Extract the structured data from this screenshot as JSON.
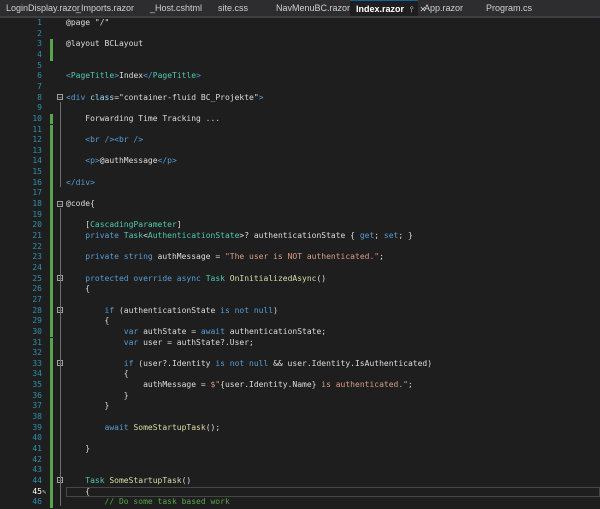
{
  "tabs": [
    {
      "label": "LoginDisplay.razor",
      "active": false
    },
    {
      "label": "_Imports.razor",
      "active": false
    },
    {
      "label": "_Host.cshtml",
      "active": false
    },
    {
      "label": "site.css",
      "active": false
    },
    {
      "label": "NavMenuBC.razor",
      "active": false
    },
    {
      "label": "Index.razor",
      "active": true
    },
    {
      "label": "App.razor",
      "active": false
    },
    {
      "label": "Program.cs",
      "active": false
    }
  ],
  "active_tab_icons": {
    "pin": "pin-icon",
    "close": "close-icon"
  },
  "colors": {
    "keyword": "#569cd6",
    "type": "#4ec9b0",
    "method": "#dcdcaa",
    "string": "#d69d85",
    "comment": "#57a64a",
    "change_bar": "#57a64a",
    "line_number": "#2b91af"
  },
  "current_line": 45,
  "lines": [
    {
      "n": 1,
      "tokens": [
        [
          "cx",
          "@page \"/\""
        ]
      ]
    },
    {
      "n": 2,
      "tokens": []
    },
    {
      "n": 3,
      "tokens": [
        [
          "cx",
          "@layout BCLayout"
        ]
      ]
    },
    {
      "n": 4,
      "tokens": []
    },
    {
      "n": 5,
      "tokens": []
    },
    {
      "n": 6,
      "tokens": [
        [
          "tg",
          "<"
        ],
        [
          "ty",
          "PageTitle"
        ],
        [
          "tg",
          ">"
        ],
        [
          "cx",
          "Index"
        ],
        [
          "tg",
          "</"
        ],
        [
          "ty",
          "PageTitle"
        ],
        [
          "tg",
          ">"
        ]
      ]
    },
    {
      "n": 7,
      "tokens": []
    },
    {
      "n": 8,
      "tokens": [
        [
          "tg",
          "<div "
        ],
        [
          "at",
          "class"
        ],
        [
          "cx",
          "=\"container-fluid BC_Projekte\""
        ],
        [
          "tg",
          ">"
        ]
      ]
    },
    {
      "n": 9,
      "tokens": []
    },
    {
      "n": 10,
      "tokens": [
        [
          "cx",
          "    Forwarding Time Tracking ..."
        ]
      ]
    },
    {
      "n": 11,
      "tokens": []
    },
    {
      "n": 12,
      "tokens": [
        [
          "cx",
          "    "
        ],
        [
          "tg",
          "<br /><br />"
        ]
      ]
    },
    {
      "n": 13,
      "tokens": []
    },
    {
      "n": 14,
      "tokens": [
        [
          "cx",
          "    "
        ],
        [
          "tg",
          "<p>"
        ],
        [
          "cx",
          "@authMessage"
        ],
        [
          "tg",
          "</p>"
        ]
      ]
    },
    {
      "n": 15,
      "tokens": []
    },
    {
      "n": 16,
      "tokens": [
        [
          "tg",
          "</div>"
        ]
      ]
    },
    {
      "n": 17,
      "tokens": []
    },
    {
      "n": 18,
      "tokens": [
        [
          "cx",
          "@code{"
        ]
      ]
    },
    {
      "n": 19,
      "tokens": []
    },
    {
      "n": 20,
      "tokens": [
        [
          "cx",
          "    ["
        ],
        [
          "ty",
          "CascadingParameter"
        ],
        [
          "cx",
          "]"
        ]
      ]
    },
    {
      "n": 21,
      "tokens": [
        [
          "kw",
          "    private "
        ],
        [
          "ty",
          "Task"
        ],
        [
          "cx",
          "<"
        ],
        [
          "ty",
          "AuthenticationState"
        ],
        [
          "cx",
          ">? authenticationState { "
        ],
        [
          "kw",
          "get"
        ],
        [
          "cx",
          "; "
        ],
        [
          "kw",
          "set"
        ],
        [
          "cx",
          "; }"
        ]
      ]
    },
    {
      "n": 22,
      "tokens": []
    },
    {
      "n": 23,
      "tokens": [
        [
          "kw",
          "    private string "
        ],
        [
          "cx",
          "authMessage = "
        ],
        [
          "st",
          "\"The user is NOT authenticated.\""
        ],
        [
          "cx",
          ";"
        ]
      ]
    },
    {
      "n": 24,
      "tokens": []
    },
    {
      "n": 25,
      "tokens": [
        [
          "kw",
          "    protected override async "
        ],
        [
          "ty",
          "Task "
        ],
        [
          "fn",
          "OnInitializedAsync"
        ],
        [
          "cx",
          "()"
        ]
      ]
    },
    {
      "n": 26,
      "tokens": [
        [
          "cx",
          "    {"
        ]
      ]
    },
    {
      "n": 27,
      "tokens": []
    },
    {
      "n": 28,
      "tokens": [
        [
          "kw",
          "        if "
        ],
        [
          "cx",
          "(authenticationState "
        ],
        [
          "kw",
          "is not null"
        ],
        [
          "cx",
          ")"
        ]
      ]
    },
    {
      "n": 29,
      "tokens": [
        [
          "cx",
          "        {"
        ]
      ]
    },
    {
      "n": 30,
      "tokens": [
        [
          "kw",
          "            var "
        ],
        [
          "cx",
          "authState = "
        ],
        [
          "kw",
          "await "
        ],
        [
          "cx",
          "authenticationState;"
        ]
      ]
    },
    {
      "n": 31,
      "tokens": [
        [
          "kw",
          "            var "
        ],
        [
          "cx",
          "user = authState?.User;"
        ]
      ]
    },
    {
      "n": 32,
      "tokens": []
    },
    {
      "n": 33,
      "tokens": [
        [
          "kw",
          "            if "
        ],
        [
          "cx",
          "(user?.Identity "
        ],
        [
          "kw",
          "is not null "
        ],
        [
          "cx",
          "&& user.Identity.IsAuthenticated)"
        ]
      ]
    },
    {
      "n": 34,
      "tokens": [
        [
          "cx",
          "            {"
        ]
      ]
    },
    {
      "n": 35,
      "tokens": [
        [
          "cx",
          "                authMessage = "
        ],
        [
          "st",
          "$\""
        ],
        [
          "cx",
          "{user.Identity.Name}"
        ],
        [
          "st",
          " is authenticated.\""
        ],
        [
          "cx",
          ";"
        ]
      ]
    },
    {
      "n": 36,
      "tokens": [
        [
          "cx",
          "            }"
        ]
      ]
    },
    {
      "n": 37,
      "tokens": [
        [
          "cx",
          "        }"
        ]
      ]
    },
    {
      "n": 38,
      "tokens": []
    },
    {
      "n": 39,
      "tokens": [
        [
          "kw",
          "        await "
        ],
        [
          "fn",
          "SomeStartupTask"
        ],
        [
          "cx",
          "();"
        ]
      ]
    },
    {
      "n": 40,
      "tokens": []
    },
    {
      "n": 41,
      "tokens": [
        [
          "cx",
          "    }"
        ]
      ]
    },
    {
      "n": 42,
      "tokens": []
    },
    {
      "n": 43,
      "tokens": []
    },
    {
      "n": 44,
      "tokens": [
        [
          "ty",
          "    Task "
        ],
        [
          "fn",
          "SomeStartupTask"
        ],
        [
          "cx",
          "()"
        ]
      ]
    },
    {
      "n": 45,
      "tokens": [
        [
          "cx",
          "    {"
        ]
      ]
    },
    {
      "n": 46,
      "tokens": [
        [
          "cm",
          "        // Do some task based work"
        ]
      ]
    }
  ],
  "change_bars": [
    3,
    4,
    10,
    11,
    12,
    13,
    14,
    15,
    16,
    17,
    18,
    19,
    20,
    21,
    22,
    23,
    24,
    25,
    26,
    27,
    28,
    29,
    30,
    31,
    32,
    33,
    34,
    35,
    36,
    37,
    38,
    39,
    40,
    41,
    42,
    43,
    44,
    45,
    46
  ],
  "fold_markers": [
    8,
    18,
    25,
    28,
    33,
    44
  ]
}
